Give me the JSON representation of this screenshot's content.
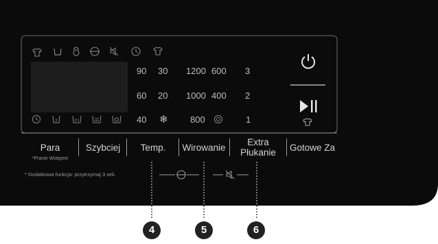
{
  "top_icons": [
    "shirt-steam-icon",
    "tub-icon",
    "child-lock-icon",
    "stain-icon",
    "mute-icon",
    "delay-timer-icon",
    "shirt-icon"
  ],
  "bottom_icons": [
    "clock-icon",
    "prewash-tub-icon",
    "double-tub-icon",
    "eco-tub-icon",
    "drum-icon"
  ],
  "temperatures": {
    "row1": [
      "90",
      "30"
    ],
    "row2": [
      "60",
      "20"
    ],
    "row3_value": "40",
    "row3_icon": "snowflake-icon"
  },
  "spin": {
    "row1": [
      "1200",
      "600"
    ],
    "row2": [
      "1000",
      "400"
    ],
    "row3_value": "800",
    "row3_icon": "no-spin-icon"
  },
  "rinse": [
    "3",
    "2",
    "1"
  ],
  "buttons": {
    "para": "Para",
    "para_sub": "*Pranie Wstępne",
    "szybciej": "Szybciej",
    "temp": "Temp.",
    "wirowanie": "Wirowanie",
    "extra_line1": "Extra",
    "extra_line2": "Płukanie",
    "gotowe": "Gotowe Za"
  },
  "footnote": "* Dodatkowa funkcja: przytrzymaj 3 sek.",
  "combo_icons": [
    "stain-icon",
    "mute-icon"
  ],
  "power": "power-icon",
  "start_pause": "play-pause-icon",
  "start_pause_sub": "shirt-icon",
  "callouts": [
    "4",
    "5",
    "6"
  ],
  "colors": {
    "panel": "#0b0b0b",
    "text": "#bdbdbd",
    "outline": "#8d8d8d",
    "callout": "#222222"
  }
}
